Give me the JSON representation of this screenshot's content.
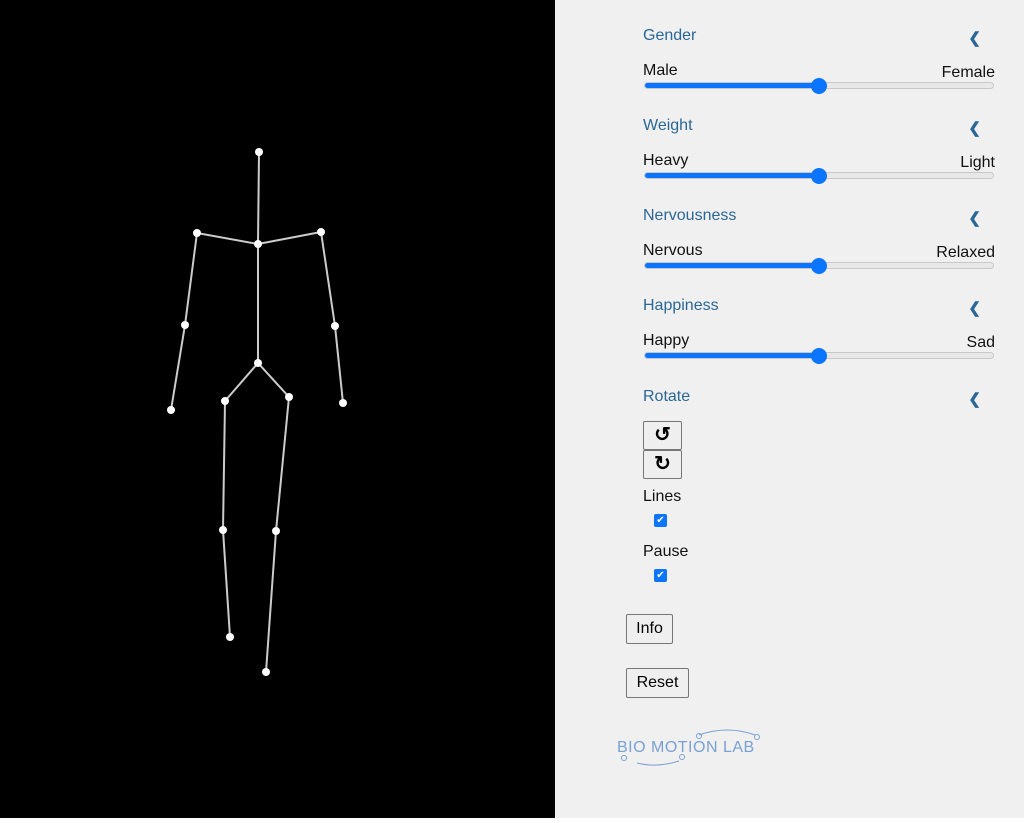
{
  "colors": {
    "accent": "#0b75ff",
    "heading": "#2a6796",
    "stage_bg": "#000000",
    "panel_bg": "#f0f0f0"
  },
  "sliders": [
    {
      "title": "Gender",
      "left": "Male",
      "right": "Female",
      "value": 0.5
    },
    {
      "title": "Weight",
      "left": "Heavy",
      "right": "Light",
      "value": 0.5
    },
    {
      "title": "Nervousness",
      "left": "Nervous",
      "right": "Relaxed",
      "value": 0.5
    },
    {
      "title": "Happiness",
      "left": "Happy",
      "right": "Sad",
      "value": 0.5
    }
  ],
  "rotate": {
    "title": "Rotate",
    "ccw_icon": "rotate-ccw-icon",
    "cw_icon": "rotate-cw-icon",
    "ccw": "↺",
    "cw": "↻"
  },
  "lines": {
    "label": "Lines",
    "checked": true
  },
  "pause": {
    "label": "Pause",
    "checked": true
  },
  "info_label": "Info",
  "reset_label": "Reset",
  "logo": "BIO MOTION LAB"
}
